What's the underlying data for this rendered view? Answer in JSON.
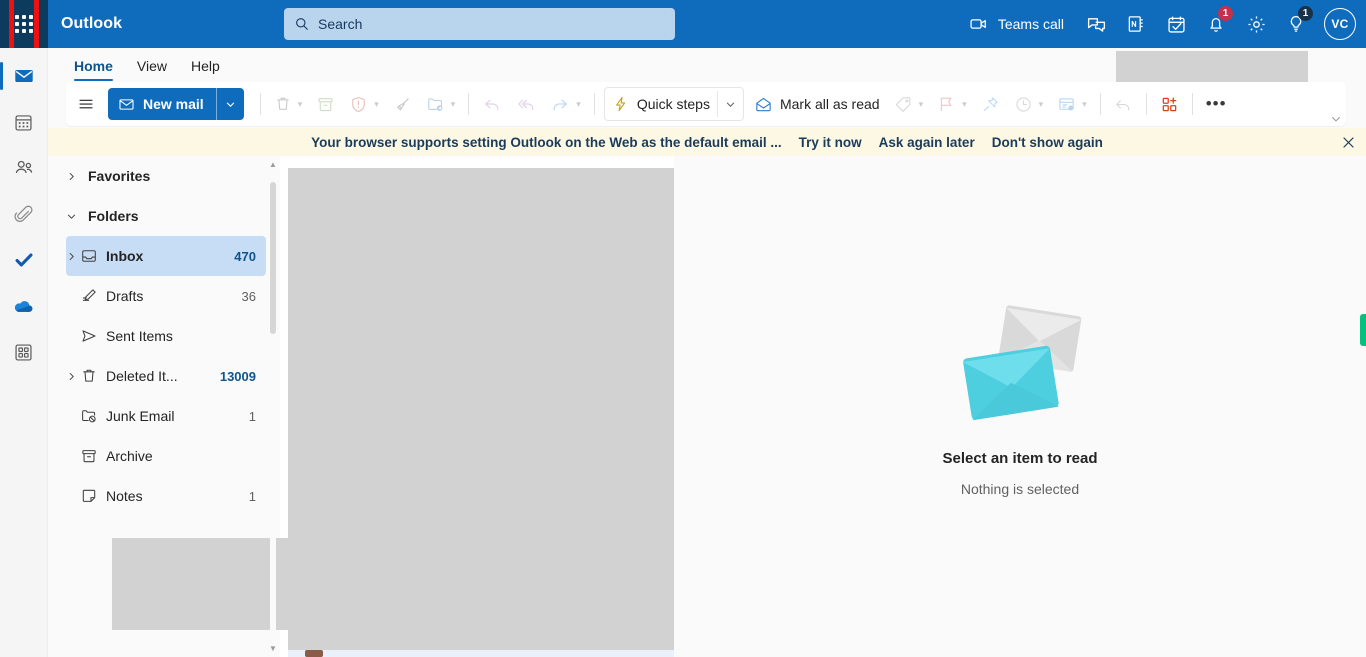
{
  "app": {
    "brand": "Outlook",
    "accent": "#0f6cbd",
    "rail_selected_color": "#0f6cbd",
    "banner_bg": "#fdf8e3",
    "selected_folder_bg": "#c7dcf5"
  },
  "search": {
    "placeholder": "Search",
    "icon": "search-icon"
  },
  "topbar": {
    "waffle": {
      "name": "app-launcher",
      "highlighted": true,
      "highlight_color": "#ee1111"
    },
    "actions": [
      {
        "name": "teams-call-button",
        "icon": "video-camera-icon",
        "label": "Teams call",
        "badge": ""
      },
      {
        "name": "chat-button",
        "icon": "chat-icon",
        "label": "",
        "badge": ""
      },
      {
        "name": "notes-button",
        "icon": "onenote-icon",
        "label": "",
        "badge": ""
      },
      {
        "name": "my-day-button",
        "icon": "calendar-check-icon",
        "label": "",
        "badge": ""
      },
      {
        "name": "notifications-button",
        "icon": "bell-icon",
        "label": "",
        "badge": "1"
      },
      {
        "name": "settings-button",
        "icon": "gear-icon",
        "label": "",
        "badge": ""
      },
      {
        "name": "feedback-button",
        "icon": "lightbulb-icon",
        "label": "",
        "badge": "1"
      }
    ],
    "avatar": {
      "initials": "VC",
      "name": "account-avatar"
    }
  },
  "rail": {
    "items": [
      {
        "name": "rail-mail",
        "icon": "mail-icon",
        "selected": true
      },
      {
        "name": "rail-calendar",
        "icon": "calendar-icon",
        "selected": false
      },
      {
        "name": "rail-people",
        "icon": "people-icon",
        "selected": false
      },
      {
        "name": "rail-files",
        "icon": "paperclip-icon",
        "selected": false
      },
      {
        "name": "rail-todo",
        "icon": "checkmark-icon",
        "selected": false
      },
      {
        "name": "rail-onedrive",
        "icon": "cloud-icon",
        "selected": false
      },
      {
        "name": "rail-apps",
        "icon": "apps-grid-icon",
        "selected": false
      }
    ]
  },
  "ribbon": {
    "tabs": [
      {
        "label": "Home",
        "active": true
      },
      {
        "label": "View",
        "active": false
      },
      {
        "label": "Help",
        "active": false
      }
    ],
    "new_mail": "New mail",
    "quick_steps": "Quick steps",
    "mark_all_as_read": "Mark all as read",
    "more_label": "•••",
    "buttons": [
      {
        "name": "hamburger-menu-button",
        "icon": "hamburger-icon",
        "label": ""
      },
      {
        "name": "delete-button",
        "icon": "trash-icon",
        "label": ""
      },
      {
        "name": "archive-button",
        "icon": "archive-icon",
        "label": ""
      },
      {
        "name": "report-button",
        "icon": "shield-alert-icon",
        "label": ""
      },
      {
        "name": "sweep-button",
        "icon": "broom-icon",
        "label": ""
      },
      {
        "name": "move-to-button",
        "icon": "folder-arrow-icon",
        "label": ""
      },
      {
        "name": "reply-button",
        "icon": "reply-icon",
        "label": ""
      },
      {
        "name": "reply-all-button",
        "icon": "reply-all-icon",
        "label": ""
      },
      {
        "name": "forward-button",
        "icon": "forward-icon",
        "label": ""
      },
      {
        "name": "tag-button",
        "icon": "tag-icon",
        "label": ""
      },
      {
        "name": "flag-button",
        "icon": "flag-icon",
        "label": ""
      },
      {
        "name": "pin-button",
        "icon": "pin-icon",
        "label": ""
      },
      {
        "name": "snooze-button",
        "icon": "clock-icon",
        "label": ""
      },
      {
        "name": "rules-button",
        "icon": "rules-icon",
        "label": ""
      },
      {
        "name": "undo-button",
        "icon": "undo-icon",
        "label": ""
      },
      {
        "name": "add-ins-button",
        "icon": "add-ins-icon",
        "label": ""
      }
    ]
  },
  "banner": {
    "text": "Your browser supports setting Outlook on the Web as the default email ...",
    "links": [
      "Try it now",
      "Ask again later",
      "Don't show again"
    ],
    "close_icon": "close-icon"
  },
  "folders": {
    "favorites_label": "Favorites",
    "folders_label": "Folders",
    "items": [
      {
        "name": "folder-inbox",
        "label": "Inbox",
        "count": "470",
        "selected": true,
        "expandable": true,
        "icon": "inbox-icon",
        "count_style": "blue"
      },
      {
        "name": "folder-drafts",
        "label": "Drafts",
        "count": "36",
        "selected": false,
        "expandable": false,
        "icon": "drafts-icon",
        "count_style": "gray"
      },
      {
        "name": "folder-sent-items",
        "label": "Sent Items",
        "count": "",
        "selected": false,
        "expandable": false,
        "icon": "sent-icon",
        "count_style": "gray"
      },
      {
        "name": "folder-deleted",
        "label": "Deleted It...",
        "count": "13009",
        "selected": false,
        "expandable": true,
        "icon": "trash-icon",
        "count_style": "blue"
      },
      {
        "name": "folder-junk",
        "label": "Junk Email",
        "count": "1",
        "selected": false,
        "expandable": false,
        "icon": "junk-icon",
        "count_style": "gray"
      },
      {
        "name": "folder-archive",
        "label": "Archive",
        "count": "",
        "selected": false,
        "expandable": false,
        "icon": "archive-icon",
        "count_style": "gray"
      },
      {
        "name": "folder-notes",
        "label": "Notes",
        "count": "1",
        "selected": false,
        "expandable": false,
        "icon": "notes-icon",
        "count_style": "gray"
      }
    ]
  },
  "reading_pane": {
    "title": "Select an item to read",
    "subtitle": "Nothing is selected",
    "art": "two-envelopes-illustration"
  }
}
